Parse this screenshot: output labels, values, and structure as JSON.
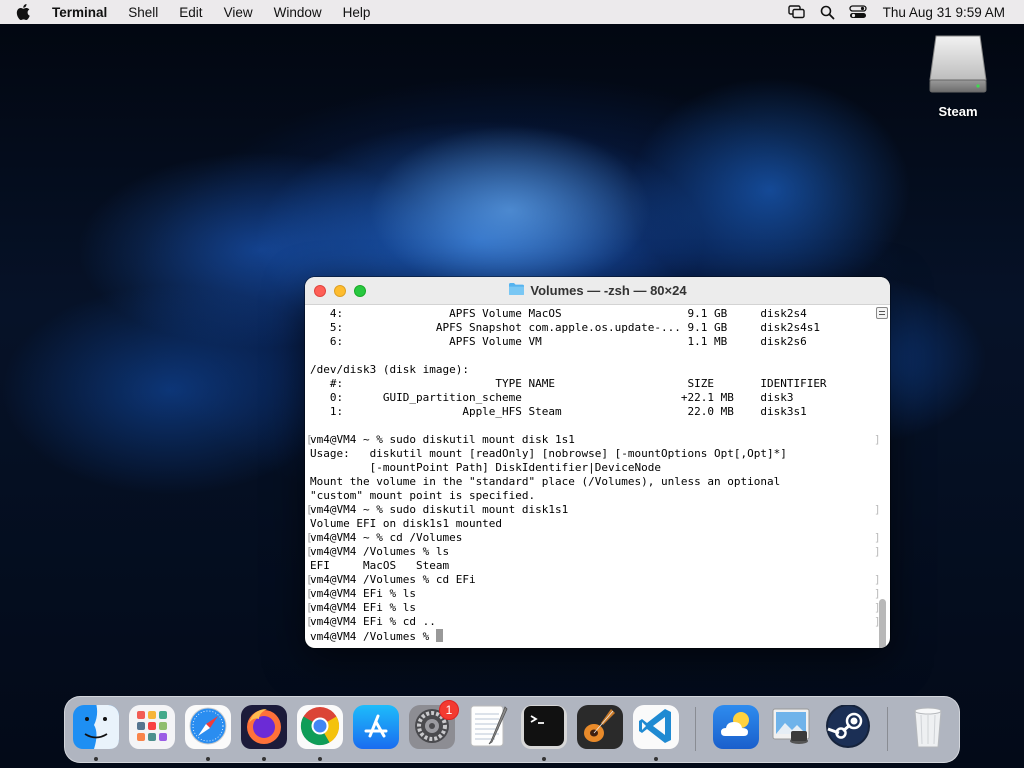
{
  "menubar": {
    "app_name": "Terminal",
    "items": [
      "Shell",
      "Edit",
      "View",
      "Window",
      "Help"
    ],
    "clock": "Thu Aug 31  9:59 AM",
    "status_icons": [
      "screen-mirroring-icon",
      "search-icon",
      "control-center-icon"
    ]
  },
  "desktop": {
    "icon_label": "Steam",
    "icon": "external-drive-icon"
  },
  "terminal": {
    "title": "Volumes — -zsh — 80×24",
    "title_icon": "folder-icon",
    "lines": [
      "   4:                APFS Volume MacOS                   9.1 GB     disk2s4",
      "   5:              APFS Snapshot com.apple.os.update-... 9.1 GB     disk2s4s1",
      "   6:                APFS Volume VM                      1.1 MB     disk2s6",
      "",
      "/dev/disk3 (disk image):",
      "   #:                       TYPE NAME                    SIZE       IDENTIFIER",
      "   0:      GUID_partition_scheme                        +22.1 MB    disk3",
      "   1:                  Apple_HFS Steam                   22.0 MB    disk3s1",
      "",
      "vm4@VM4 ~ % sudo diskutil mount disk 1s1",
      "Usage:   diskutil mount [readOnly] [nobrowse] [-mountOptions Opt[,Opt]*]",
      "         [-mountPoint Path] DiskIdentifier|DeviceNode",
      "Mount the volume in the \"standard\" place (/Volumes), unless an optional",
      "\"custom\" mount point is specified.",
      "vm4@VM4 ~ % sudo diskutil mount disk1s1",
      "Volume EFI on disk1s1 mounted",
      "vm4@VM4 ~ % cd /Volumes",
      "vm4@VM4 /Volumes % ls",
      "EFI     MacOS   Steam",
      "vm4@VM4 /Volumes % cd EFi",
      "vm4@VM4 EFi % ls",
      "vm4@VM4 EFi % ls",
      "vm4@VM4 EFi % cd ..",
      "vm4@VM4 /Volumes % "
    ],
    "prompt_lines": [
      9,
      14,
      16,
      17,
      19,
      20,
      21,
      22
    ]
  },
  "dock": {
    "items": [
      {
        "name": "Finder",
        "icon": "finder-icon",
        "running": true
      },
      {
        "name": "Launchpad",
        "icon": "launchpad-icon",
        "running": false
      },
      {
        "name": "Safari",
        "icon": "safari-icon",
        "running": true
      },
      {
        "name": "Firefox",
        "icon": "firefox-icon",
        "running": true
      },
      {
        "name": "Chrome",
        "icon": "chrome-icon",
        "running": true
      },
      {
        "name": "App Store",
        "icon": "app-store-icon",
        "running": false
      },
      {
        "name": "System Settings",
        "icon": "system-settings-icon",
        "running": false
      },
      {
        "name": "TextEdit",
        "icon": "textedit-icon",
        "running": false
      },
      {
        "name": "Terminal",
        "icon": "terminal-icon",
        "running": true
      },
      {
        "name": "GarageBand",
        "icon": "garageband-icon",
        "running": false
      },
      {
        "name": "Visual Studio Code",
        "icon": "vscode-icon",
        "running": true
      },
      {
        "name": "Weather",
        "icon": "weather-icon",
        "running": false
      },
      {
        "name": "Preview",
        "icon": "preview-icon",
        "running": false
      },
      {
        "name": "Steam",
        "icon": "steam-icon",
        "running": false
      },
      {
        "name": "Trash",
        "icon": "trash-icon",
        "running": false
      }
    ],
    "settings_badge": "1"
  }
}
